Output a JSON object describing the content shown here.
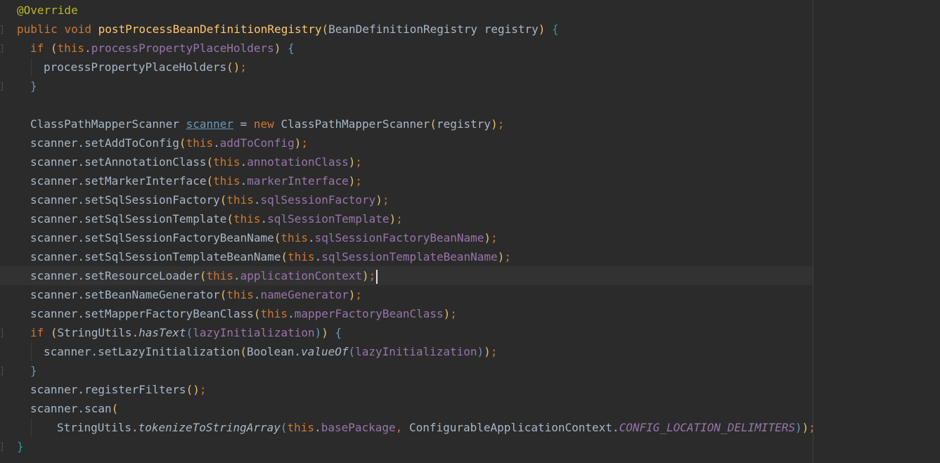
{
  "editor": {
    "colors": {
      "background": "#2b2b2b",
      "keyword": "#cc7832",
      "method": "#ffc66d",
      "field": "#9876aa",
      "annotation": "#bbb529",
      "default": "#a9b7c6"
    },
    "lines": [
      {
        "indent": 1,
        "tokens": [
          {
            "t": "@Override",
            "c": "anno"
          }
        ]
      },
      {
        "indent": 1,
        "tokens": [
          {
            "t": "public ",
            "c": "kw"
          },
          {
            "t": "void ",
            "c": "kw"
          },
          {
            "t": "postProcessBeanDefinitionRegistry",
            "c": "m"
          },
          {
            "t": "(",
            "c": "p1"
          },
          {
            "t": "BeanDefinitionRegistry registry",
            "c": "d"
          },
          {
            "t": ") ",
            "c": "p1"
          },
          {
            "t": "{",
            "c": "b2"
          }
        ]
      },
      {
        "indent": 2,
        "tokens": [
          {
            "t": "if ",
            "c": "kw"
          },
          {
            "t": "(",
            "c": "p1"
          },
          {
            "t": "this",
            "c": "kw"
          },
          {
            "t": ".",
            "c": "d"
          },
          {
            "t": "processPropertyPlaceHolders",
            "c": "f"
          },
          {
            "t": ") ",
            "c": "p1"
          },
          {
            "t": "{",
            "c": "p2"
          }
        ]
      },
      {
        "indent": 3,
        "tokens": [
          {
            "t": "processPropertyPlaceHolders",
            "c": "d"
          },
          {
            "t": "()",
            "c": "p1"
          },
          {
            "t": ";",
            "c": "punct"
          }
        ]
      },
      {
        "indent": 2,
        "tokens": [
          {
            "t": "}",
            "c": "p2"
          }
        ]
      },
      {
        "indent": 0,
        "tokens": []
      },
      {
        "indent": 2,
        "tokens": [
          {
            "t": "ClassPathMapperScanner ",
            "c": "d"
          },
          {
            "t": "scanner",
            "c": "link"
          },
          {
            "t": " = ",
            "c": "d"
          },
          {
            "t": "new ",
            "c": "kw"
          },
          {
            "t": "ClassPathMapperScanner",
            "c": "d"
          },
          {
            "t": "(",
            "c": "p1"
          },
          {
            "t": "registry",
            "c": "d"
          },
          {
            "t": ")",
            "c": "p1"
          },
          {
            "t": ";",
            "c": "punct"
          }
        ]
      },
      {
        "indent": 2,
        "tokens": [
          {
            "t": "scanner.setAddToConfig",
            "c": "d"
          },
          {
            "t": "(",
            "c": "p1"
          },
          {
            "t": "this",
            "c": "kw"
          },
          {
            "t": ".",
            "c": "d"
          },
          {
            "t": "addToConfig",
            "c": "f"
          },
          {
            "t": ")",
            "c": "p1"
          },
          {
            "t": ";",
            "c": "punct"
          }
        ]
      },
      {
        "indent": 2,
        "tokens": [
          {
            "t": "scanner.setAnnotationClass",
            "c": "d"
          },
          {
            "t": "(",
            "c": "p1"
          },
          {
            "t": "this",
            "c": "kw"
          },
          {
            "t": ".",
            "c": "d"
          },
          {
            "t": "annotationClass",
            "c": "f"
          },
          {
            "t": ")",
            "c": "p1"
          },
          {
            "t": ";",
            "c": "punct"
          }
        ]
      },
      {
        "indent": 2,
        "tokens": [
          {
            "t": "scanner.setMarkerInterface",
            "c": "d"
          },
          {
            "t": "(",
            "c": "p1"
          },
          {
            "t": "this",
            "c": "kw"
          },
          {
            "t": ".",
            "c": "d"
          },
          {
            "t": "markerInterface",
            "c": "f"
          },
          {
            "t": ")",
            "c": "p1"
          },
          {
            "t": ";",
            "c": "punct"
          }
        ]
      },
      {
        "indent": 2,
        "tokens": [
          {
            "t": "scanner.setSqlSessionFactory",
            "c": "d"
          },
          {
            "t": "(",
            "c": "p1"
          },
          {
            "t": "this",
            "c": "kw"
          },
          {
            "t": ".",
            "c": "d"
          },
          {
            "t": "sqlSessionFactory",
            "c": "f"
          },
          {
            "t": ")",
            "c": "p1"
          },
          {
            "t": ";",
            "c": "punct"
          }
        ]
      },
      {
        "indent": 2,
        "tokens": [
          {
            "t": "scanner.setSqlSessionTemplate",
            "c": "d"
          },
          {
            "t": "(",
            "c": "p1"
          },
          {
            "t": "this",
            "c": "kw"
          },
          {
            "t": ".",
            "c": "d"
          },
          {
            "t": "sqlSessionTemplate",
            "c": "f"
          },
          {
            "t": ")",
            "c": "p1"
          },
          {
            "t": ";",
            "c": "punct"
          }
        ]
      },
      {
        "indent": 2,
        "tokens": [
          {
            "t": "scanner.setSqlSessionFactoryBeanName",
            "c": "d"
          },
          {
            "t": "(",
            "c": "p1"
          },
          {
            "t": "this",
            "c": "kw"
          },
          {
            "t": ".",
            "c": "d"
          },
          {
            "t": "sqlSessionFactoryBeanName",
            "c": "f"
          },
          {
            "t": ")",
            "c": "p1"
          },
          {
            "t": ";",
            "c": "punct"
          }
        ]
      },
      {
        "indent": 2,
        "tokens": [
          {
            "t": "scanner.setSqlSessionTemplateBeanName",
            "c": "d"
          },
          {
            "t": "(",
            "c": "p1"
          },
          {
            "t": "this",
            "c": "kw"
          },
          {
            "t": ".",
            "c": "d"
          },
          {
            "t": "sqlSessionTemplateBeanName",
            "c": "f"
          },
          {
            "t": ")",
            "c": "p1"
          },
          {
            "t": ";",
            "c": "punct"
          }
        ]
      },
      {
        "indent": 2,
        "current": true,
        "tokens": [
          {
            "t": "scanner.setResourceLoader",
            "c": "d"
          },
          {
            "t": "(",
            "c": "p1"
          },
          {
            "t": "this",
            "c": "kw"
          },
          {
            "t": ".",
            "c": "d"
          },
          {
            "t": "applicationContext",
            "c": "f"
          },
          {
            "t": ")",
            "c": "p1"
          },
          {
            "t": ";",
            "c": "punct"
          }
        ]
      },
      {
        "indent": 2,
        "tokens": [
          {
            "t": "scanner.setBeanNameGenerator",
            "c": "d"
          },
          {
            "t": "(",
            "c": "p1"
          },
          {
            "t": "this",
            "c": "kw"
          },
          {
            "t": ".",
            "c": "d"
          },
          {
            "t": "nameGenerator",
            "c": "f"
          },
          {
            "t": ")",
            "c": "p1"
          },
          {
            "t": ";",
            "c": "punct"
          }
        ]
      },
      {
        "indent": 2,
        "tokens": [
          {
            "t": "scanner.setMapperFactoryBeanClass",
            "c": "d"
          },
          {
            "t": "(",
            "c": "p1"
          },
          {
            "t": "this",
            "c": "kw"
          },
          {
            "t": ".",
            "c": "d"
          },
          {
            "t": "mapperFactoryBeanClass",
            "c": "f"
          },
          {
            "t": ")",
            "c": "p1"
          },
          {
            "t": ";",
            "c": "punct"
          }
        ]
      },
      {
        "indent": 2,
        "tokens": [
          {
            "t": "if ",
            "c": "kw"
          },
          {
            "t": "(",
            "c": "p1"
          },
          {
            "t": "StringUtils.",
            "c": "d"
          },
          {
            "t": "hasText",
            "c": "st"
          },
          {
            "t": "(",
            "c": "p2"
          },
          {
            "t": "lazyInitialization",
            "c": "f"
          },
          {
            "t": ")",
            "c": "p2"
          },
          {
            "t": ") ",
            "c": "p1"
          },
          {
            "t": "{",
            "c": "p2"
          }
        ]
      },
      {
        "indent": 3,
        "tokens": [
          {
            "t": "scanner.setLazyInitialization",
            "c": "d"
          },
          {
            "t": "(",
            "c": "p1"
          },
          {
            "t": "Boolean.",
            "c": "d"
          },
          {
            "t": "valueOf",
            "c": "st"
          },
          {
            "t": "(",
            "c": "p2"
          },
          {
            "t": "lazyInitialization",
            "c": "f"
          },
          {
            "t": ")",
            "c": "p2"
          },
          {
            "t": ")",
            "c": "p1"
          },
          {
            "t": ";",
            "c": "punct"
          }
        ]
      },
      {
        "indent": 2,
        "tokens": [
          {
            "t": "}",
            "c": "p2"
          }
        ]
      },
      {
        "indent": 2,
        "tokens": [
          {
            "t": "scanner.registerFilters",
            "c": "d"
          },
          {
            "t": "()",
            "c": "p1"
          },
          {
            "t": ";",
            "c": "punct"
          }
        ]
      },
      {
        "indent": 2,
        "tokens": [
          {
            "t": "scanner.scan",
            "c": "d"
          },
          {
            "t": "(",
            "c": "p1"
          }
        ]
      },
      {
        "indent": 4,
        "tokens": [
          {
            "t": "StringUtils.",
            "c": "d"
          },
          {
            "t": "tokenizeToStringArray",
            "c": "st"
          },
          {
            "t": "(",
            "c": "p2"
          },
          {
            "t": "this",
            "c": "kw"
          },
          {
            "t": ".",
            "c": "d"
          },
          {
            "t": "basePackage",
            "c": "f"
          },
          {
            "t": ", ",
            "c": "punct"
          },
          {
            "t": "ConfigurableApplicationContext.",
            "c": "d"
          },
          {
            "t": "CONFIG_LOCATION_DELIMITERS",
            "c": "sf"
          },
          {
            "t": ")",
            "c": "p2"
          },
          {
            "t": ")",
            "c": "p1"
          },
          {
            "t": ";",
            "c": "punct"
          }
        ]
      },
      {
        "indent": 1,
        "tokens": [
          {
            "t": "}",
            "c": "b2"
          }
        ]
      }
    ]
  }
}
